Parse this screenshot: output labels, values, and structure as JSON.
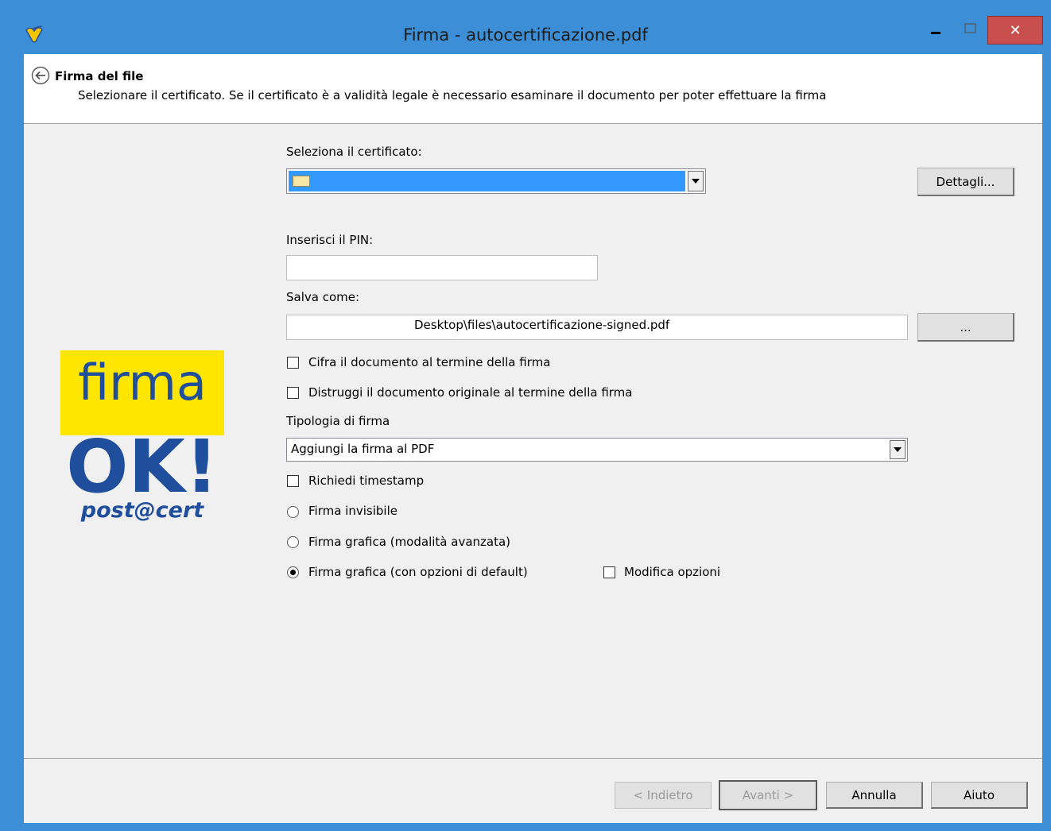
{
  "window": {
    "title": "Firma - autocertificazione.pdf",
    "close_symbol": "✕",
    "colors": {
      "frame": "#3c8fd6",
      "close": "#c94f4f",
      "selection": "#3399ff"
    }
  },
  "header": {
    "title": "Firma del file",
    "description": "Selezionare il certificato. Se il certificato è a validità legale è necessario esaminare il documento per poter effettuare la firma"
  },
  "logo": {
    "line1": "firma",
    "line2": "OK!",
    "line3": "post@cert",
    "colors": {
      "yellow": "#ffe600",
      "blue": "#1f4e9c"
    }
  },
  "form": {
    "certificate_label": "Seleziona il certificato:",
    "details_button": "Dettagli...",
    "pin_label": "Inserisci il PIN:",
    "pin_value": "",
    "save_label": "Salva come:",
    "save_path": "Desktop\\files\\autocertificazione-signed.pdf",
    "browse_button": "...",
    "encrypt_checkbox": "Cifra il documento al termine della firma",
    "destroy_checkbox": "Distruggi il documento originale al termine della firma",
    "type_label": "Tipologia di firma",
    "type_value": "Aggiungi la firma al PDF",
    "timestamp_checkbox": "Richiedi timestamp",
    "radio_invisible": "Firma invisibile",
    "radio_advanced": "Firma grafica (modalità avanzata)",
    "radio_default": "Firma grafica (con opzioni di default)",
    "modify_checkbox": "Modifica opzioni",
    "selected_radio": "radio_default"
  },
  "footer": {
    "back_button": "< Indietro",
    "next_button": "Avanti >",
    "cancel_button": "Annulla",
    "help_button": "Aiuto"
  }
}
